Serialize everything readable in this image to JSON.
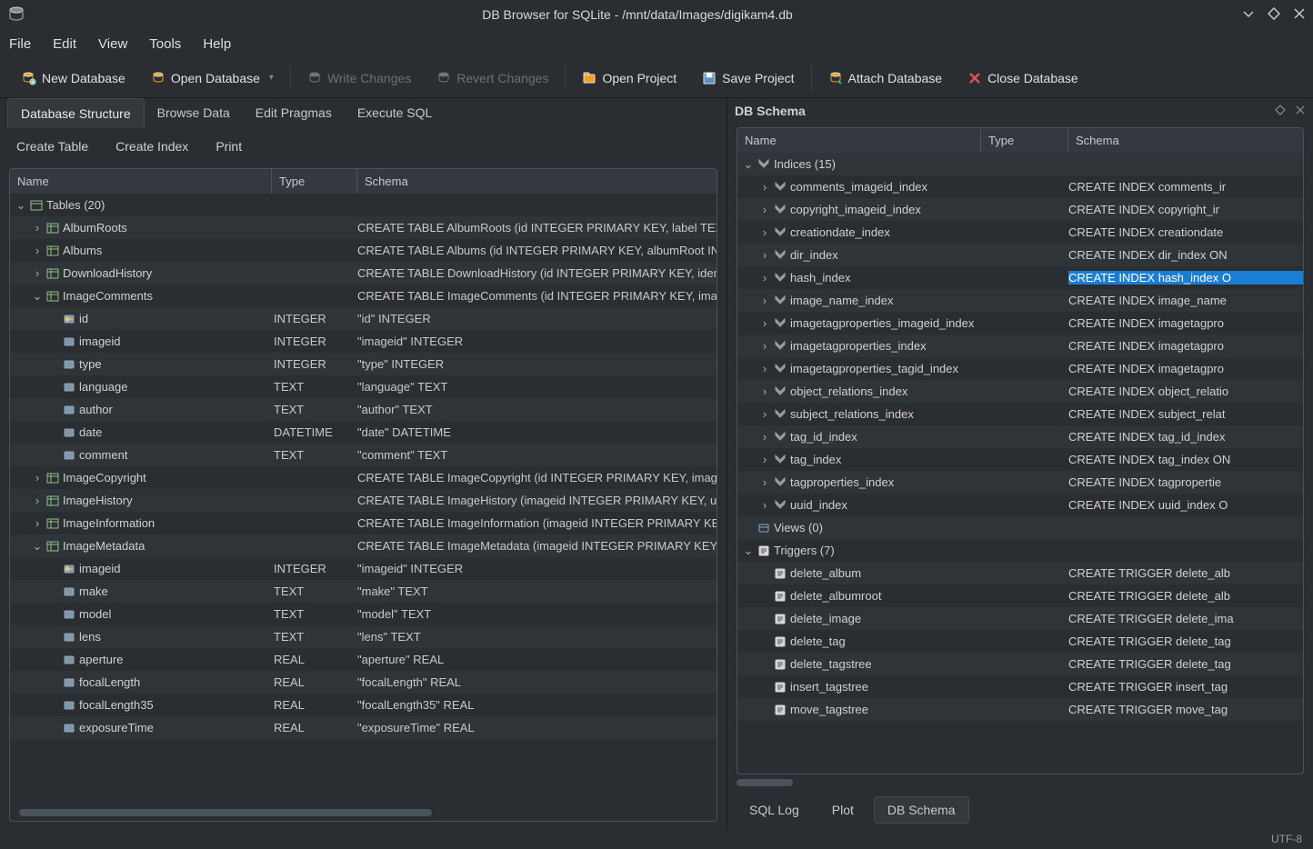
{
  "window": {
    "title": "DB Browser for SQLite - /mnt/data/Images/digikam4.db"
  },
  "menu": [
    "File",
    "Edit",
    "View",
    "Tools",
    "Help"
  ],
  "toolbar": [
    {
      "label": "New Database",
      "icon": "db-new",
      "enabled": true
    },
    {
      "label": "Open Database",
      "icon": "db-open",
      "enabled": true,
      "dropdown": true
    },
    {
      "sep": true
    },
    {
      "label": "Write Changes",
      "icon": "db-write",
      "enabled": false
    },
    {
      "label": "Revert Changes",
      "icon": "db-revert",
      "enabled": false
    },
    {
      "sep": true
    },
    {
      "label": "Open Project",
      "icon": "proj-open",
      "enabled": true
    },
    {
      "label": "Save Project",
      "icon": "proj-save",
      "enabled": true
    },
    {
      "sep": true
    },
    {
      "label": "Attach Database",
      "icon": "db-attach",
      "enabled": true
    },
    {
      "label": "Close Database",
      "icon": "db-close",
      "enabled": true
    }
  ],
  "main_tabs": [
    "Database Structure",
    "Browse Data",
    "Edit Pragmas",
    "Execute SQL"
  ],
  "active_main_tab": 0,
  "subtoolbar": [
    {
      "label": "Create Table",
      "icon": "table-create"
    },
    {
      "label": "Create Index",
      "icon": "index-create"
    },
    {
      "label": "Print",
      "icon": "print"
    }
  ],
  "structure_headers": [
    "Name",
    "Type",
    "Schema"
  ],
  "structure_tree": [
    {
      "name": "Tables (20)",
      "icon": "table-group",
      "indent": 0,
      "expanded": true
    },
    {
      "name": "AlbumRoots",
      "icon": "table",
      "indent": 1,
      "schema": "CREATE TABLE AlbumRoots (id INTEGER PRIMARY KEY, label TEXT,",
      "expander": ">"
    },
    {
      "name": "Albums",
      "icon": "table",
      "indent": 1,
      "schema": "CREATE TABLE Albums (id INTEGER PRIMARY KEY, albumRoot INT",
      "expander": ">"
    },
    {
      "name": "DownloadHistory",
      "icon": "table",
      "indent": 1,
      "schema": "CREATE TABLE DownloadHistory (id INTEGER PRIMARY KEY, ident",
      "expander": ">"
    },
    {
      "name": "ImageComments",
      "icon": "table",
      "indent": 1,
      "schema": "CREATE TABLE ImageComments (id INTEGER PRIMARY KEY, imag",
      "expander": "v",
      "expanded": true
    },
    {
      "name": "id",
      "icon": "field-key",
      "indent": 2,
      "type": "INTEGER",
      "schema": "\"id\" INTEGER"
    },
    {
      "name": "imageid",
      "icon": "field",
      "indent": 2,
      "type": "INTEGER",
      "schema": "\"imageid\" INTEGER"
    },
    {
      "name": "type",
      "icon": "field",
      "indent": 2,
      "type": "INTEGER",
      "schema": "\"type\" INTEGER"
    },
    {
      "name": "language",
      "icon": "field",
      "indent": 2,
      "type": "TEXT",
      "schema": "\"language\" TEXT"
    },
    {
      "name": "author",
      "icon": "field",
      "indent": 2,
      "type": "TEXT",
      "schema": "\"author\" TEXT"
    },
    {
      "name": "date",
      "icon": "field",
      "indent": 2,
      "type": "DATETIME",
      "schema": "\"date\" DATETIME"
    },
    {
      "name": "comment",
      "icon": "field",
      "indent": 2,
      "type": "TEXT",
      "schema": "\"comment\" TEXT"
    },
    {
      "name": "ImageCopyright",
      "icon": "table",
      "indent": 1,
      "schema": "CREATE TABLE ImageCopyright (id INTEGER PRIMARY KEY, image",
      "expander": ">"
    },
    {
      "name": "ImageHistory",
      "icon": "table",
      "indent": 1,
      "schema": "CREATE TABLE ImageHistory (imageid INTEGER PRIMARY KEY, uu",
      "expander": ">"
    },
    {
      "name": "ImageInformation",
      "icon": "table",
      "indent": 1,
      "schema": "CREATE TABLE ImageInformation (imageid INTEGER PRIMARY KE",
      "expander": ">"
    },
    {
      "name": "ImageMetadata",
      "icon": "table",
      "indent": 1,
      "schema": "CREATE TABLE ImageMetadata (imageid INTEGER PRIMARY KEY, r",
      "expander": "v",
      "expanded": true
    },
    {
      "name": "imageid",
      "icon": "field-key",
      "indent": 2,
      "type": "INTEGER",
      "schema": "\"imageid\" INTEGER"
    },
    {
      "name": "make",
      "icon": "field",
      "indent": 2,
      "type": "TEXT",
      "schema": "\"make\" TEXT"
    },
    {
      "name": "model",
      "icon": "field",
      "indent": 2,
      "type": "TEXT",
      "schema": "\"model\" TEXT"
    },
    {
      "name": "lens",
      "icon": "field",
      "indent": 2,
      "type": "TEXT",
      "schema": "\"lens\" TEXT"
    },
    {
      "name": "aperture",
      "icon": "field",
      "indent": 2,
      "type": "REAL",
      "schema": "\"aperture\" REAL"
    },
    {
      "name": "focalLength",
      "icon": "field",
      "indent": 2,
      "type": "REAL",
      "schema": "\"focalLength\" REAL"
    },
    {
      "name": "focalLength35",
      "icon": "field",
      "indent": 2,
      "type": "REAL",
      "schema": "\"focalLength35\" REAL"
    },
    {
      "name": "exposureTime",
      "icon": "field",
      "indent": 2,
      "type": "REAL",
      "schema": "\"exposureTime\" REAL"
    }
  ],
  "dock_title": "DB Schema",
  "schema_headers": [
    "Name",
    "Type",
    "Schema"
  ],
  "schema_tree": [
    {
      "name": "Indices (15)",
      "icon": "index-group",
      "indent": 0,
      "expanded": true,
      "expander": "v"
    },
    {
      "name": "comments_imageid_index",
      "icon": "index",
      "indent": 1,
      "schema": "CREATE INDEX comments_ir",
      "expander": ">"
    },
    {
      "name": "copyright_imageid_index",
      "icon": "index",
      "indent": 1,
      "schema": "CREATE INDEX copyright_ir",
      "expander": ">"
    },
    {
      "name": "creationdate_index",
      "icon": "index",
      "indent": 1,
      "schema": "CREATE INDEX creationdate",
      "expander": ">"
    },
    {
      "name": "dir_index",
      "icon": "index",
      "indent": 1,
      "schema": "CREATE INDEX dir_index ON",
      "expander": ">"
    },
    {
      "name": "hash_index",
      "icon": "index",
      "indent": 1,
      "schema": "CREATE INDEX hash_index O",
      "expander": ">",
      "selected": true
    },
    {
      "name": "image_name_index",
      "icon": "index",
      "indent": 1,
      "schema": "CREATE INDEX image_name",
      "expander": ">"
    },
    {
      "name": "imagetagproperties_imageid_index",
      "icon": "index",
      "indent": 1,
      "schema": "CREATE INDEX imagetagpro",
      "expander": ">"
    },
    {
      "name": "imagetagproperties_index",
      "icon": "index",
      "indent": 1,
      "schema": "CREATE INDEX imagetagpro",
      "expander": ">"
    },
    {
      "name": "imagetagproperties_tagid_index",
      "icon": "index",
      "indent": 1,
      "schema": "CREATE INDEX imagetagpro",
      "expander": ">"
    },
    {
      "name": "object_relations_index",
      "icon": "index",
      "indent": 1,
      "schema": "CREATE INDEX object_relatio",
      "expander": ">"
    },
    {
      "name": "subject_relations_index",
      "icon": "index",
      "indent": 1,
      "schema": "CREATE INDEX subject_relat",
      "expander": ">"
    },
    {
      "name": "tag_id_index",
      "icon": "index",
      "indent": 1,
      "schema": "CREATE INDEX tag_id_index",
      "expander": ">"
    },
    {
      "name": "tag_index",
      "icon": "index",
      "indent": 1,
      "schema": "CREATE INDEX tag_index ON",
      "expander": ">"
    },
    {
      "name": "tagproperties_index",
      "icon": "index",
      "indent": 1,
      "schema": "CREATE INDEX tagpropertie",
      "expander": ">"
    },
    {
      "name": "uuid_index",
      "icon": "index",
      "indent": 1,
      "schema": "CREATE INDEX uuid_index O",
      "expander": ">"
    },
    {
      "name": "Views (0)",
      "icon": "view-group",
      "indent": 0
    },
    {
      "name": "Triggers (7)",
      "icon": "trigger-group",
      "indent": 0,
      "expanded": true,
      "expander": "v"
    },
    {
      "name": "delete_album",
      "icon": "trigger",
      "indent": 1,
      "schema": "CREATE TRIGGER delete_alb"
    },
    {
      "name": "delete_albumroot",
      "icon": "trigger",
      "indent": 1,
      "schema": "CREATE TRIGGER delete_alb"
    },
    {
      "name": "delete_image",
      "icon": "trigger",
      "indent": 1,
      "schema": "CREATE TRIGGER delete_ima"
    },
    {
      "name": "delete_tag",
      "icon": "trigger",
      "indent": 1,
      "schema": "CREATE TRIGGER delete_tag"
    },
    {
      "name": "delete_tagstree",
      "icon": "trigger",
      "indent": 1,
      "schema": "CREATE TRIGGER delete_tag"
    },
    {
      "name": "insert_tagstree",
      "icon": "trigger",
      "indent": 1,
      "schema": "CREATE TRIGGER insert_tag"
    },
    {
      "name": "move_tagstree",
      "icon": "trigger",
      "indent": 1,
      "schema": "CREATE TRIGGER move_tag"
    }
  ],
  "bottom_tabs": [
    "SQL Log",
    "Plot",
    "DB Schema"
  ],
  "active_bottom_tab": 2,
  "statusbar": {
    "encoding": "UTF-8"
  },
  "colors": {
    "selection": "#1a7fd4",
    "db_icon": "#f0a020",
    "close_icon": "#e05050",
    "field_icon": "#9bc7e8",
    "key_icon": "#f0c040",
    "index_icon": "#c0c0c0",
    "table_icon": "#8fc080"
  }
}
